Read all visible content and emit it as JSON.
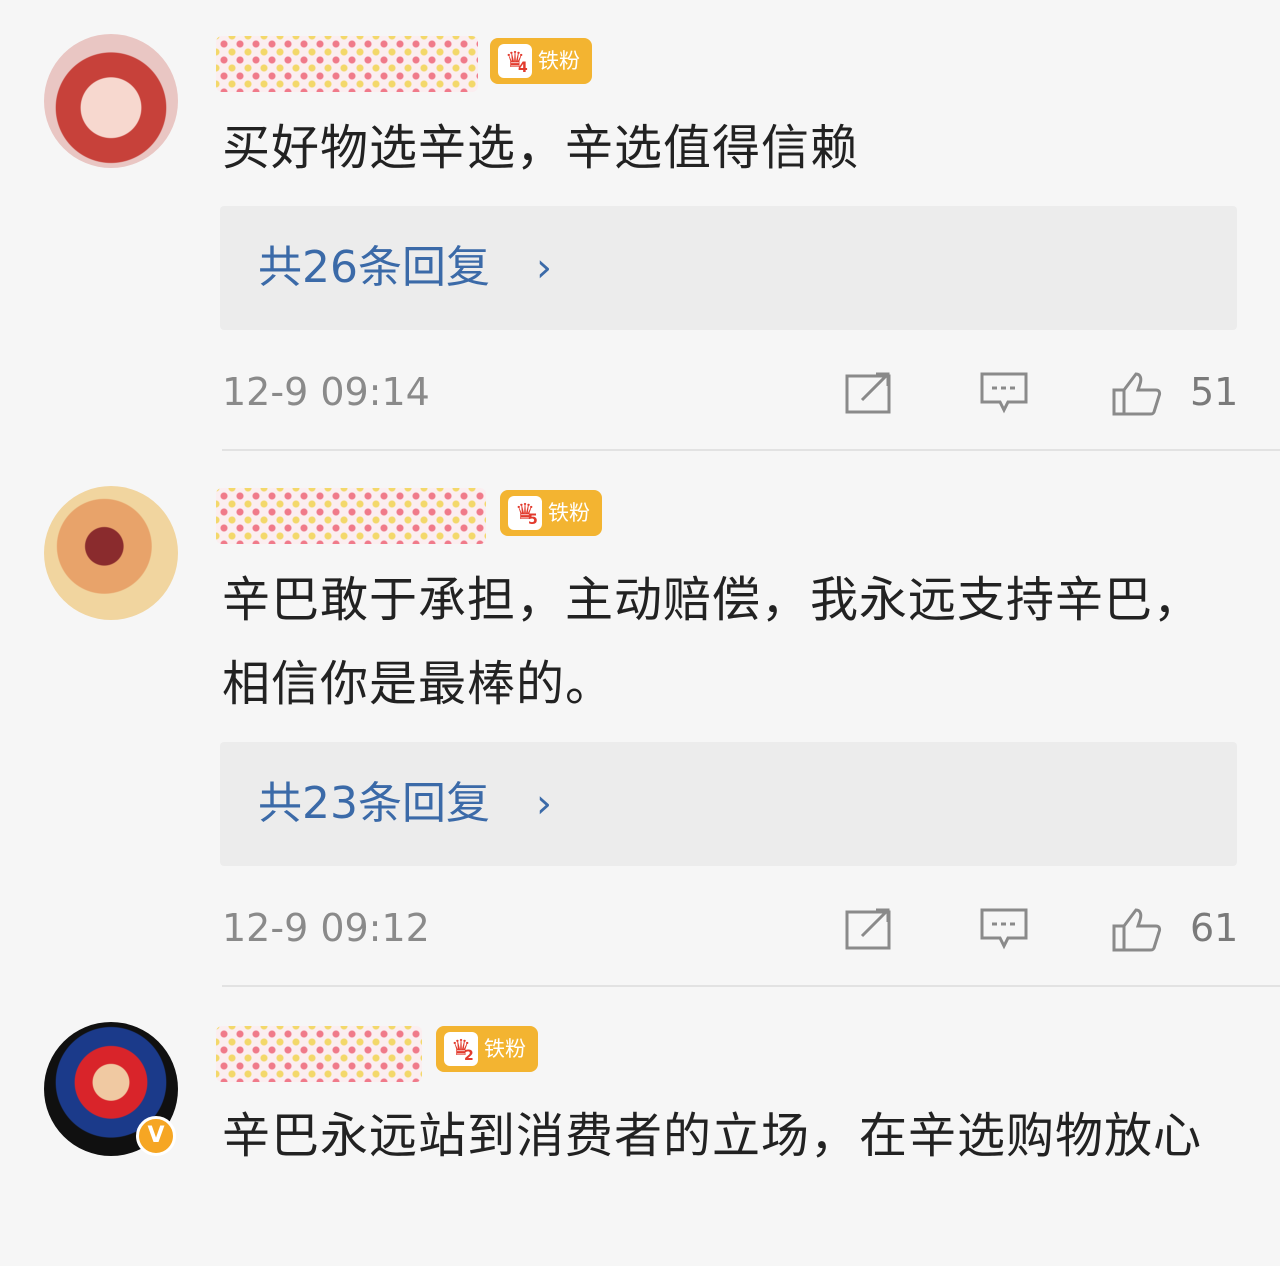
{
  "comments": [
    {
      "fan_badge": {
        "label": "铁粉",
        "level": "4"
      },
      "text": "买好物选辛选，辛选值得信赖",
      "replies": "共26条回复",
      "time": "12-9 09:14",
      "likes": "51"
    },
    {
      "fan_badge": {
        "label": "铁粉",
        "level": "5"
      },
      "text": "辛巴敢于承担，主动赔偿，我永远支持辛巴，相信你是最棒的。",
      "replies": "共23条回复",
      "time": "12-9 09:12",
      "likes": "61"
    },
    {
      "fan_badge": {
        "label": "铁粉",
        "level": "2"
      },
      "text": "辛巴永远站到消费者的立场，在辛选购物放心",
      "verified_glyph": "V"
    }
  ],
  "icons": {
    "share": "share-icon",
    "comment": "comment-icon",
    "like": "thumbs-up-icon",
    "reply_chevron": "›"
  },
  "colors": {
    "link": "#3b6aa8",
    "badge": "#f3b431",
    "background": "#f6f6f6"
  }
}
